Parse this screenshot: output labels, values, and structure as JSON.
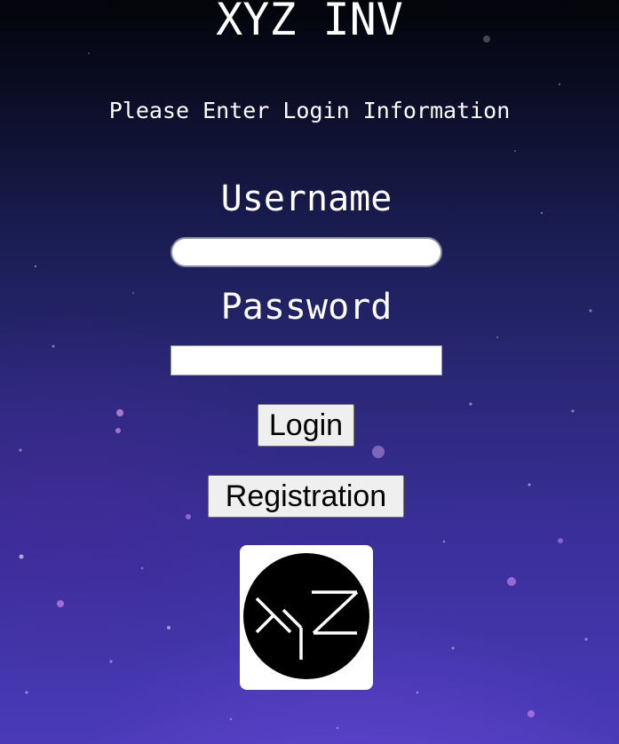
{
  "app": {
    "title": "XYZ INV",
    "subtitle": "Please Enter Login Information"
  },
  "form": {
    "username_label": "Username",
    "username_value": "",
    "password_label": "Password",
    "password_value": "",
    "login_label": "Login",
    "registration_label": "Registration"
  },
  "logo": {
    "text": "XYZ"
  },
  "colors": {
    "text": "#ffffff",
    "background_top": "#020409",
    "background_bottom": "#4a3ab8",
    "button_face": "#efefef",
    "logo_circle": "#000000"
  },
  "icons": {
    "logo": "xyz-logo-icon"
  }
}
